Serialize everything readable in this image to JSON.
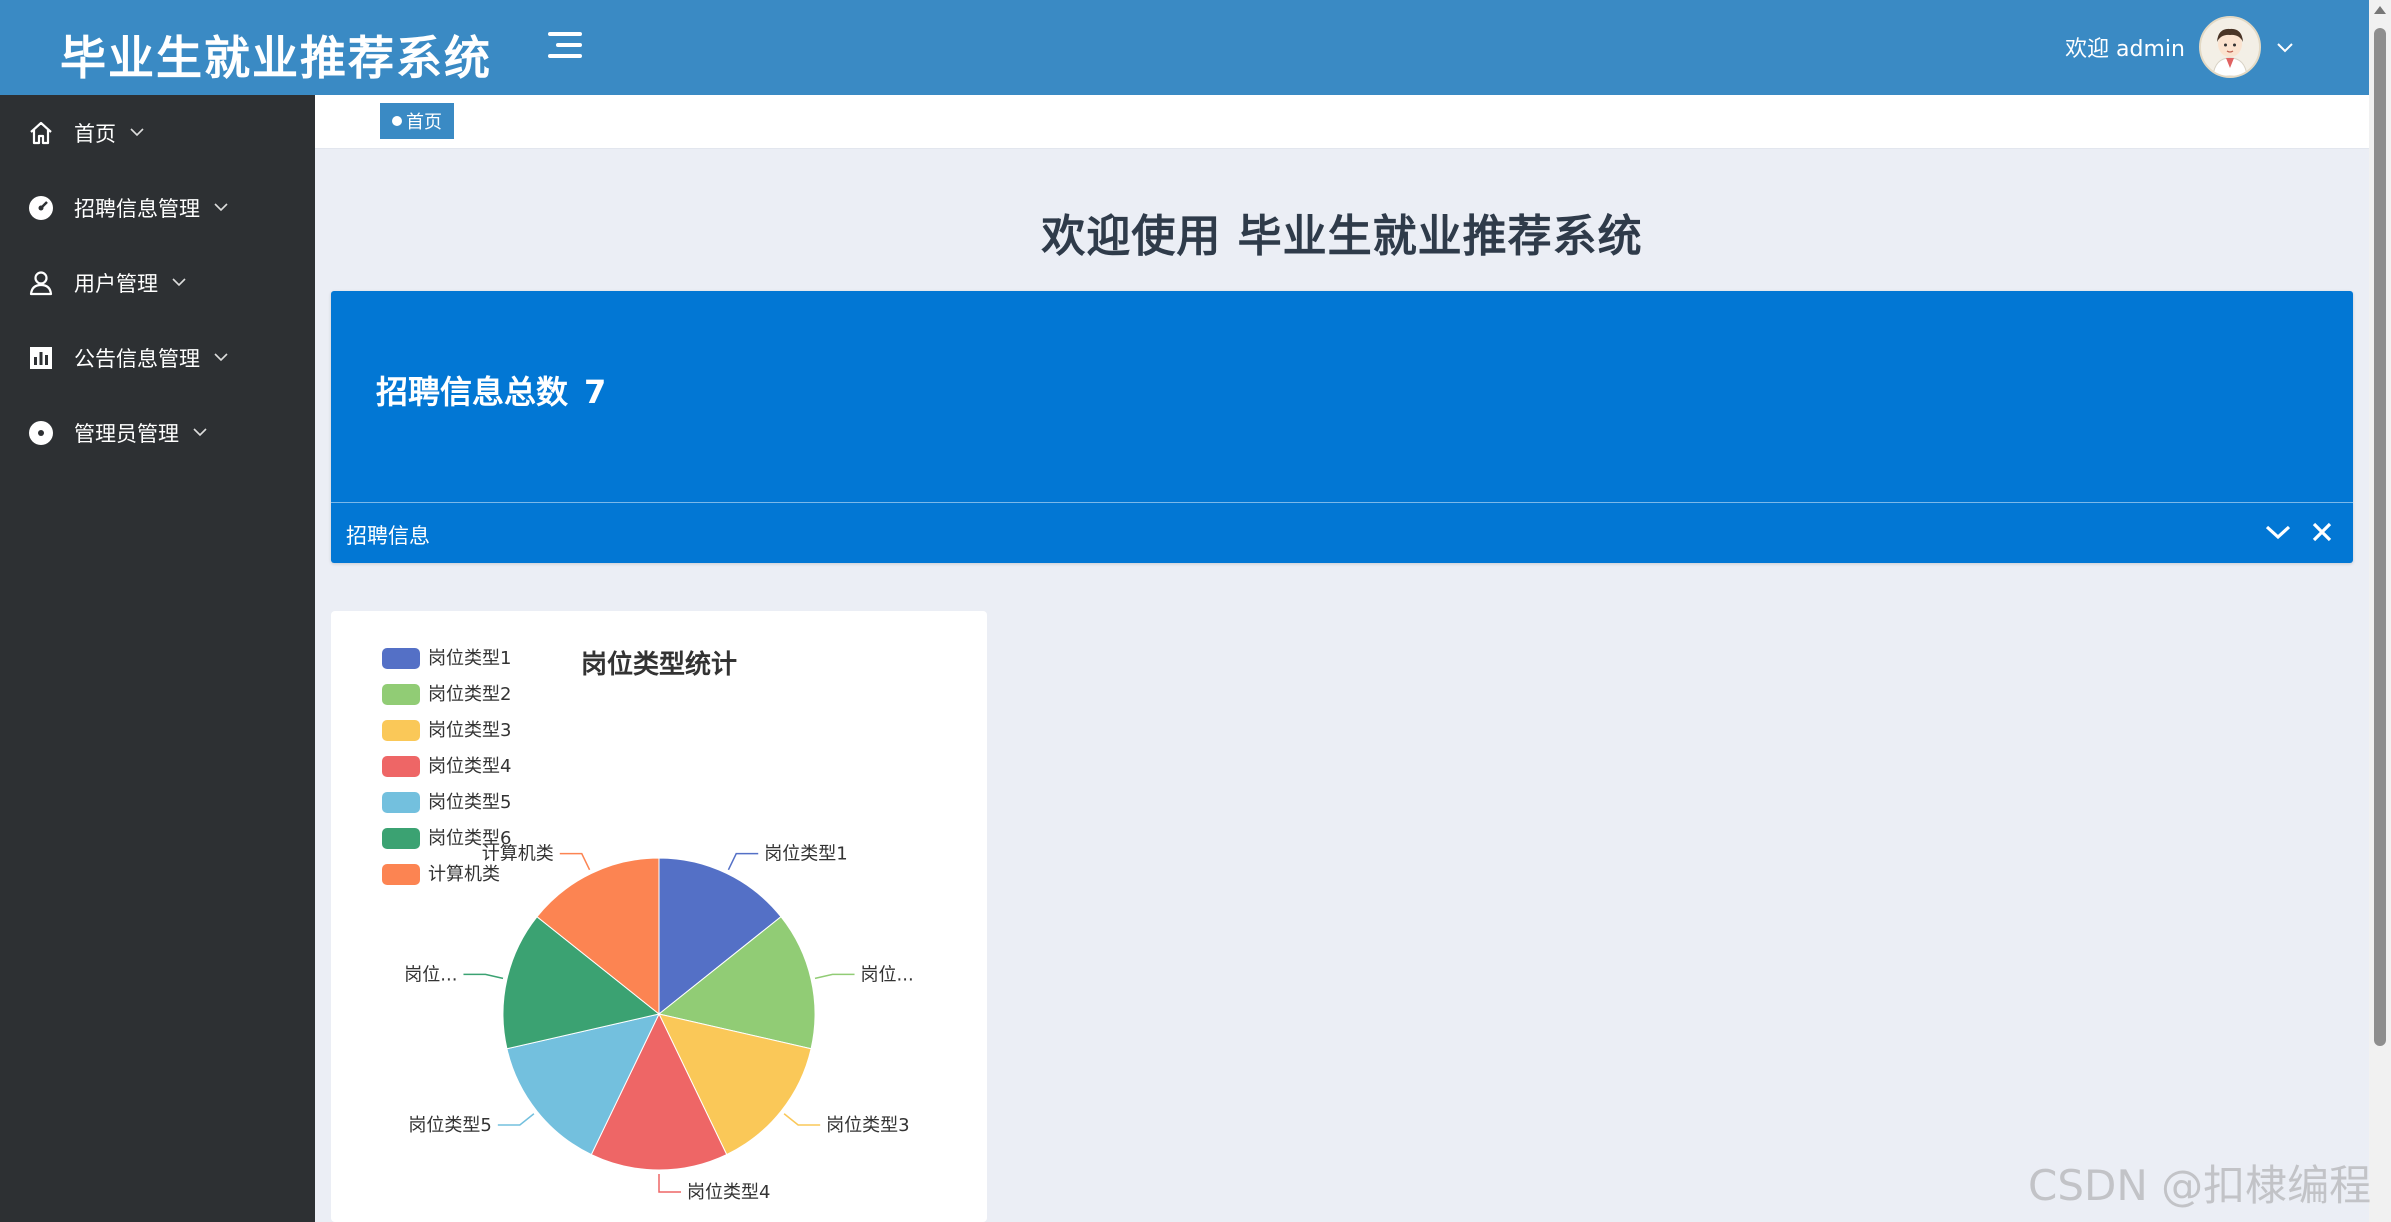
{
  "header": {
    "app_title": "毕业生就业推荐系统",
    "welcome_text": "欢迎 admin",
    "brand_color": "#3a8ac4"
  },
  "sidebar": {
    "items": [
      {
        "label": "首页",
        "icon": "home-icon"
      },
      {
        "label": "招聘信息管理",
        "icon": "gauge-icon"
      },
      {
        "label": "用户管理",
        "icon": "user-icon"
      },
      {
        "label": "公告信息管理",
        "icon": "bar-chart-icon"
      },
      {
        "label": "管理员管理",
        "icon": "disc-icon"
      }
    ]
  },
  "breadcrumb": {
    "current": "首页"
  },
  "main": {
    "welcome_heading": "欢迎使用 毕业生就业推荐系统",
    "stat_card": {
      "label": "招聘信息总数",
      "value": "7",
      "footer_label": "招聘信息",
      "color": "#0277d4"
    }
  },
  "chart_data": {
    "type": "pie",
    "title": "岗位类型统计",
    "categories": [
      "岗位类型1",
      "岗位类型2",
      "岗位类型3",
      "岗位类型4",
      "岗位类型5",
      "岗位类型6",
      "计算机类"
    ],
    "values": [
      1,
      1,
      1,
      1,
      1,
      1,
      1
    ],
    "colors": [
      "#5470c6",
      "#91cc75",
      "#fac858",
      "#ee6666",
      "#73c0de",
      "#3ba272",
      "#fc8452"
    ],
    "slice_labels": [
      "岗位类型1",
      "岗位...",
      "岗位类型3",
      "岗位类型4",
      "岗位类型5",
      "岗位...",
      "计算机类"
    ],
    "legend_position": "top-left"
  },
  "watermark": "CSDN @扣棣编程"
}
